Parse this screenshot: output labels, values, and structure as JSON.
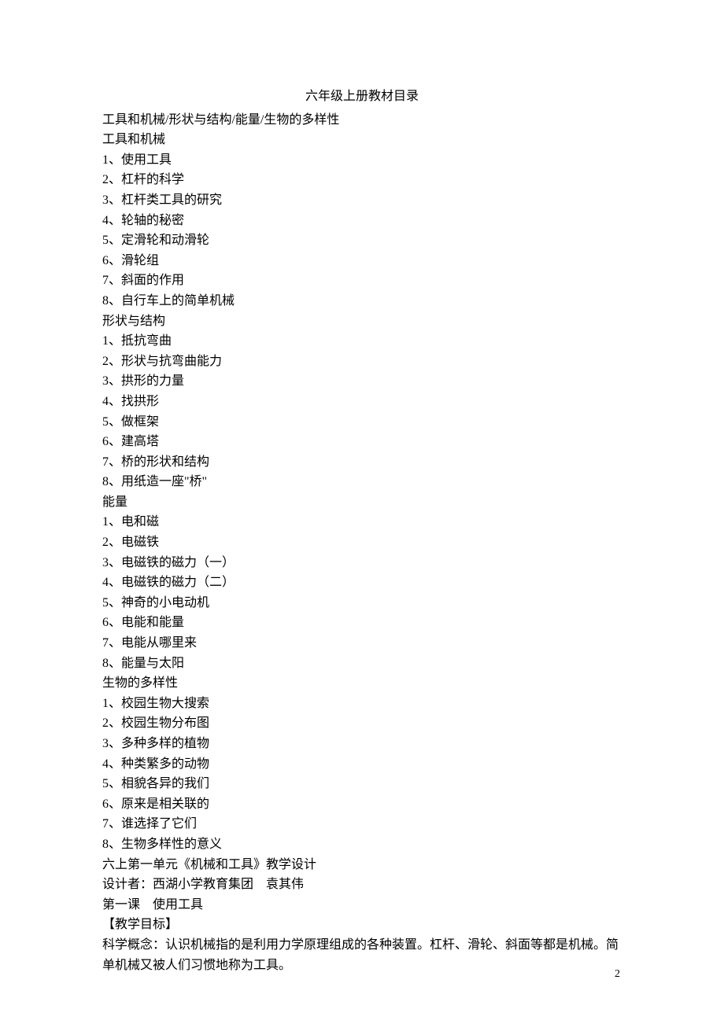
{
  "title": "六年级上册教材目录",
  "overview": "工具和机械/形状与结构/能量/生物的多样性",
  "sections": [
    {
      "heading": "工具和机械",
      "items": [
        "1、使用工具",
        "2、杠杆的科学",
        "3、杠杆类工具的研究",
        "4、轮轴的秘密",
        "5、定滑轮和动滑轮",
        "6、滑轮组",
        "7、斜面的作用",
        "8、自行车上的简单机械"
      ]
    },
    {
      "heading": "形状与结构",
      "items": [
        "1、抵抗弯曲",
        "2、形状与抗弯曲能力",
        "3、拱形的力量",
        "4、找拱形",
        "5、做框架",
        "6、建高塔",
        "7、桥的形状和结构",
        "8、用纸造一座\"桥\""
      ]
    },
    {
      "heading": "能量",
      "items": [
        "1、电和磁",
        "2、电磁铁",
        "3、电磁铁的磁力（一）",
        "4、电磁铁的磁力（二）",
        "5、神奇的小电动机",
        "6、电能和能量",
        "7、电能从哪里来",
        "8、能量与太阳"
      ]
    },
    {
      "heading": "生物的多样性",
      "items": [
        "1、校园生物大搜索",
        "2、校园生物分布图",
        "3、多种多样的植物",
        "4、种类繁多的动物",
        "5、相貌各异的我们",
        "6、原来是相关联的",
        "7、谁选择了它们",
        "8、生物多样性的意义"
      ]
    }
  ],
  "lesson": {
    "unit_title": "六上第一单元《机械和工具》教学设计",
    "designer": "设计者：西湖小学教育集团　袁其伟",
    "lesson_title": "第一课　使用工具",
    "objective_label": "【教学目标】",
    "objective_text": "科学概念：认识机械指的是利用力学原理组成的各种装置。杠杆、滑轮、斜面等都是机械。简单机械又被人们习惯地称为工具。"
  },
  "page_number": "2"
}
